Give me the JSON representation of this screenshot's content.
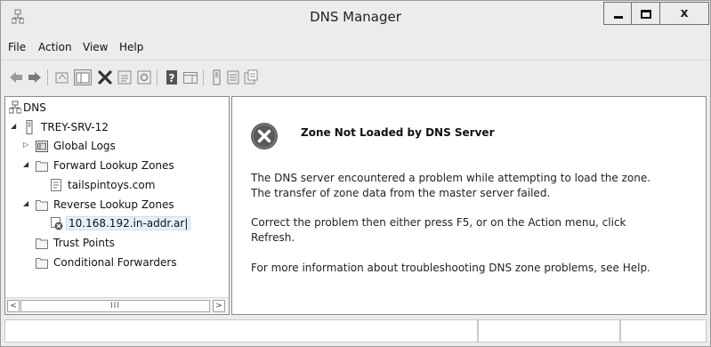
{
  "window": {
    "title": "DNS Manager"
  },
  "window_controls": {
    "minimize_icon": "minimize-icon",
    "maximize_icon": "maximize-icon",
    "close_glyph": "x"
  },
  "menu": {
    "items": [
      "File",
      "Action",
      "View",
      "Help"
    ]
  },
  "toolbar": {
    "icons": [
      "back-arrow-icon",
      "forward-arrow-icon",
      "up-folder-icon",
      "show-hide-console-tree-icon",
      "delete-icon",
      "properties-icon",
      "refresh-icon",
      "help-icon",
      "show-hide-action-pane-icon",
      "server-icon",
      "zone-list-icon",
      "new-record-icon"
    ]
  },
  "tree": {
    "items": [
      {
        "label": "DNS",
        "icon": "dns-root-icon",
        "expander": ""
      },
      {
        "label": "TREY-SRV-12",
        "icon": "server-icon",
        "expander": "◢"
      },
      {
        "label": "Global Logs",
        "icon": "log-icon",
        "expander": "▷"
      },
      {
        "label": "Forward Lookup Zones",
        "icon": "folder-icon",
        "expander": "◢"
      },
      {
        "label": "tailspintoys.com",
        "icon": "zone-icon",
        "expander": ""
      },
      {
        "label": "Reverse Lookup Zones",
        "icon": "folder-icon",
        "expander": "◢"
      },
      {
        "label": "10.168.192.in-addr.ar|",
        "icon": "zone-error-icon",
        "expander": ""
      },
      {
        "label": "Trust Points",
        "icon": "folder-icon",
        "expander": ""
      },
      {
        "label": "Conditional Forwarders",
        "icon": "folder-icon",
        "expander": ""
      }
    ],
    "scroll_left": "<",
    "scroll_right": ">",
    "scroll_thumb": "III"
  },
  "details": {
    "error_icon": "error-x-icon",
    "heading": "Zone Not Loaded by DNS Server",
    "para1_line1": "The DNS server encountered a problem while attempting to load the zone.",
    "para1_line2": "The transfer of zone data from the master server failed.",
    "para2_line1": "Correct the problem then either press F5, or on the Action menu, click",
    "para2_line2": "Refresh.",
    "para3": "For more information about troubleshooting DNS zone problems, see Help."
  },
  "colors": {
    "chrome": "#ececec",
    "error_circle": "#5a5a5a",
    "selection": "#e5f0fb"
  }
}
